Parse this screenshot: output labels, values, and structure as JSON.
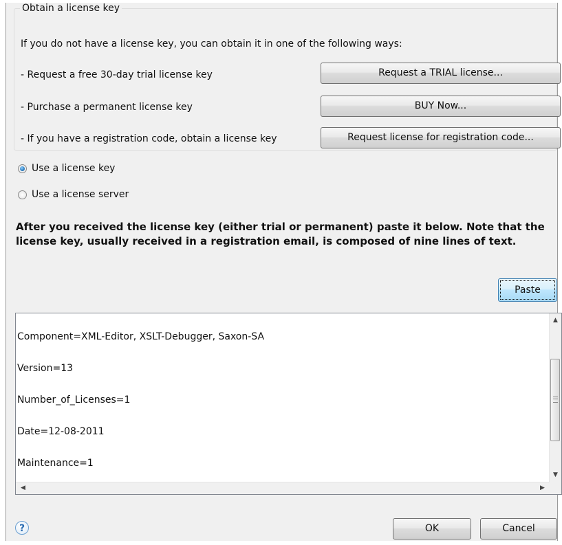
{
  "group": {
    "legend": "Obtain a license key",
    "intro": "If you do not have a license key, you can obtain it in one of the following ways:",
    "rows": [
      {
        "label": "- Request a free 30-day trial license key",
        "button": "Request a TRIAL license..."
      },
      {
        "label": "- Purchase a permanent license key",
        "button": "BUY Now..."
      },
      {
        "label": "- If you have a registration code, obtain a license key",
        "button": "Request license for registration code..."
      }
    ]
  },
  "options": {
    "use_key": "Use a license key",
    "use_server": "Use a license server",
    "selected": "use_key"
  },
  "instructions": "After you received the license key (either trial or permanent) paste it below. Note that the license key, usually received in a registration email, is composed of nine lines of text.",
  "paste_button": "Paste",
  "license_text": [
    "Component=XML-Editor, XSLT-Debugger, Saxon-SA",
    "Version=13",
    "Number_of_Licenses=1",
    "Date=12-08-2011",
    "Maintenance=1"
  ],
  "footer": {
    "help": "?",
    "ok": "OK",
    "cancel": "Cancel"
  }
}
